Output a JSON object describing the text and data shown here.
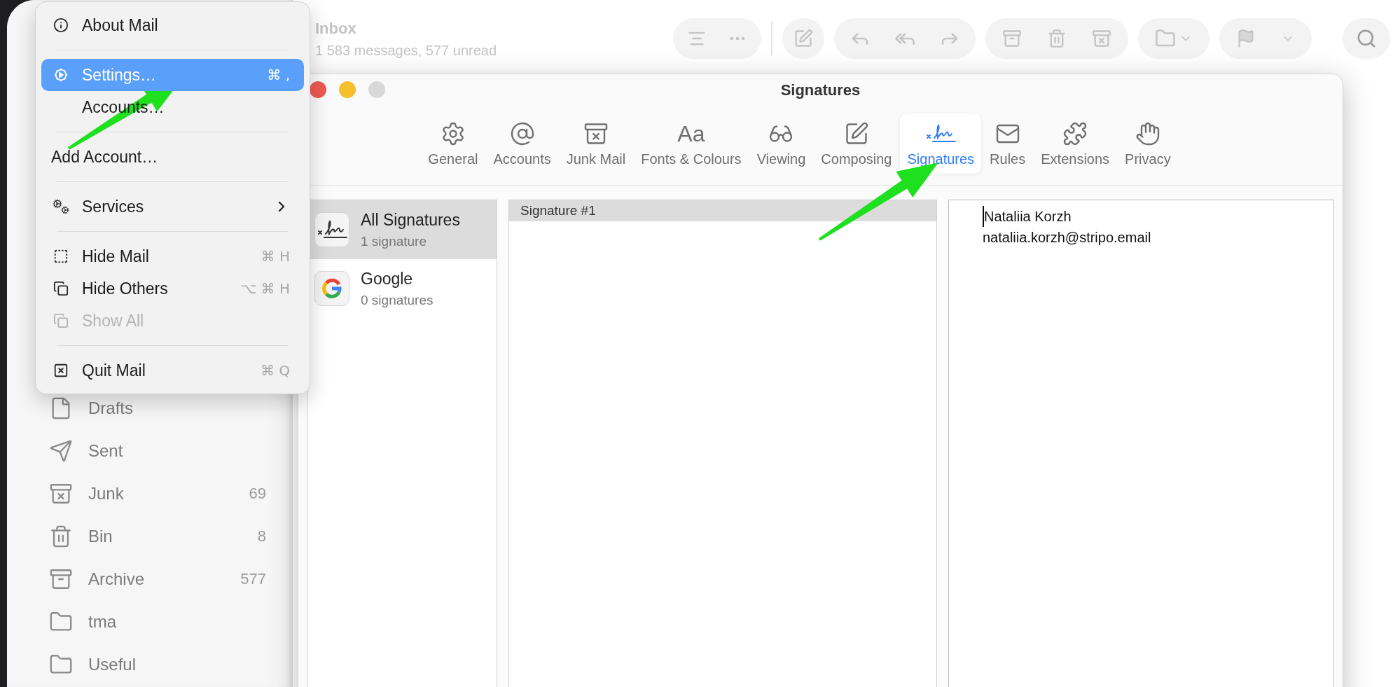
{
  "mail_window": {
    "mailbox_title": "Inbox",
    "mailbox_subtitle": "1 583 messages, 577 unread",
    "sidebar_items": [
      {
        "label": "Drafts"
      },
      {
        "label": "Sent"
      },
      {
        "label": "Junk",
        "count": "69"
      },
      {
        "label": "Bin",
        "count": "8"
      },
      {
        "label": "Archive",
        "count": "577"
      },
      {
        "label": "tma"
      },
      {
        "label": "Useful"
      }
    ]
  },
  "app_menu": {
    "items": [
      {
        "kind": "item",
        "label": "About Mail",
        "indented": true,
        "selected": false,
        "disabled": false
      },
      {
        "kind": "separator"
      },
      {
        "kind": "item",
        "label": "Settings…",
        "shortcut": "⌘ ,",
        "indented": true,
        "selected": true,
        "disabled": false
      },
      {
        "kind": "item",
        "label": "Accounts…",
        "indented": true,
        "selected": false,
        "disabled": false
      },
      {
        "kind": "separator"
      },
      {
        "kind": "item",
        "label": "Add Account…",
        "indented": false,
        "selected": false,
        "disabled": false
      },
      {
        "kind": "separator"
      },
      {
        "kind": "submenu",
        "label": "Services",
        "indented": true,
        "selected": false,
        "disabled": false
      },
      {
        "kind": "separator"
      },
      {
        "kind": "item",
        "label": "Hide Mail",
        "shortcut": "⌘ H",
        "indented": true,
        "selected": false,
        "disabled": false
      },
      {
        "kind": "item",
        "label": "Hide Others",
        "shortcut": "⌥ ⌘ H",
        "indented": true,
        "selected": false,
        "disabled": false
      },
      {
        "kind": "item",
        "label": "Show All",
        "indented": true,
        "selected": false,
        "disabled": true
      },
      {
        "kind": "separator"
      },
      {
        "kind": "item",
        "label": "Quit Mail",
        "shortcut": "⌘ Q",
        "indented": true,
        "selected": false,
        "disabled": false
      }
    ]
  },
  "settings_window": {
    "title": "Signatures",
    "tabs": [
      {
        "label": "General",
        "selected": false
      },
      {
        "label": "Accounts",
        "selected": false
      },
      {
        "label": "Junk Mail",
        "selected": false
      },
      {
        "label": "Fonts & Colours",
        "glyph": "Aa",
        "selected": false
      },
      {
        "label": "Viewing",
        "selected": false
      },
      {
        "label": "Composing",
        "selected": false
      },
      {
        "label": "Signatures",
        "selected": true
      },
      {
        "label": "Rules",
        "selected": false
      },
      {
        "label": "Extensions",
        "selected": false
      },
      {
        "label": "Privacy",
        "selected": false
      }
    ],
    "accounts": [
      {
        "name": "All Signatures",
        "count": "1 signature",
        "selected": true
      },
      {
        "name": "Google",
        "count": "0 signatures",
        "selected": false
      }
    ],
    "signatures": [
      {
        "name": "Signature #1",
        "selected": true
      }
    ],
    "signature_text": [
      "Nataliia Korzh",
      "nataliia.korzh@stripo.email"
    ]
  }
}
